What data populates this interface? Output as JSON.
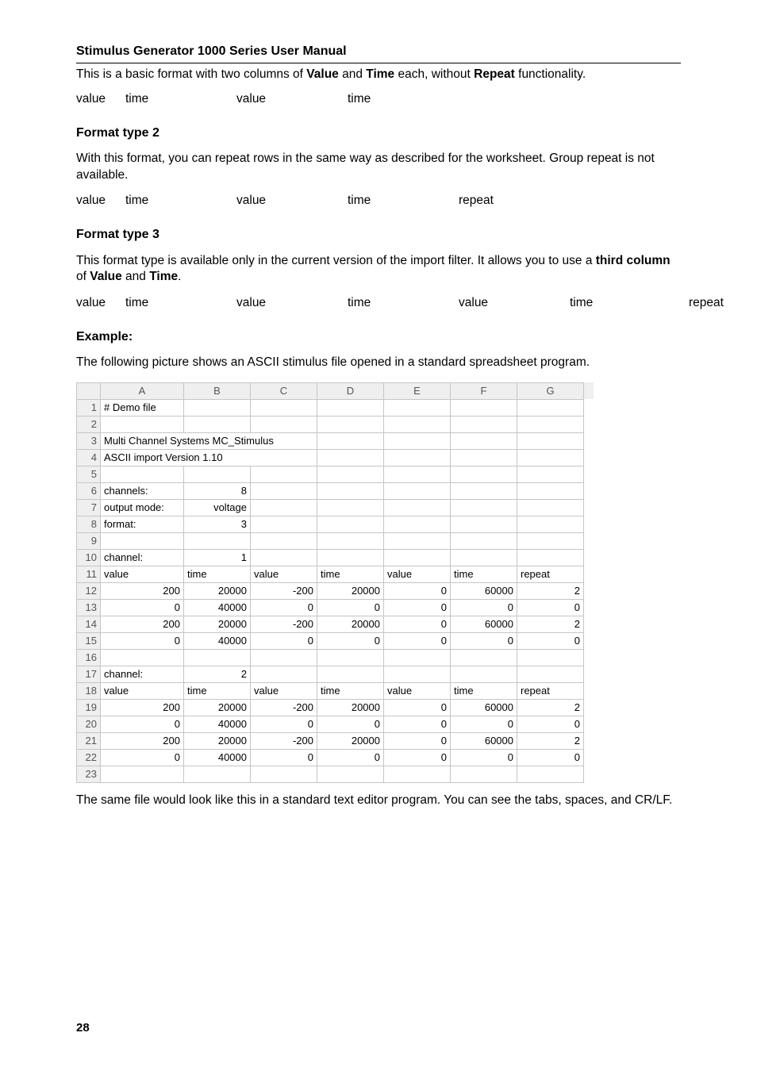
{
  "title": "Stimulus Generator 1000 Series User Manual",
  "intro": {
    "p1_a": "This is a basic format with two columns of ",
    "p1_b": " and ",
    "p1_c": " each, without ",
    "p1_d": " functionality.",
    "b1": "Value",
    "b2": "Time",
    "b3": "Repeat"
  },
  "words": {
    "value": "value",
    "time": "time",
    "repeat": "repeat"
  },
  "fmt2": {
    "h": "Format type 2",
    "p": "With this format, you can repeat rows in the same way as described for the worksheet. Group repeat is not available."
  },
  "fmt3": {
    "h": "Format type 3",
    "p_a": "This format type is available only in the current version of the import filter. It allows you to use a ",
    "p_b": " of ",
    "p_c": " and ",
    "p_d": ".",
    "b1": "third column",
    "b2": "Value",
    "b3": "Time"
  },
  "example": {
    "h": "Example:",
    "p": "The following picture shows an ASCII stimulus file opened in a standard spreadsheet program.",
    "p2": "The same file would look like this in a standard text editor program. You can see the tabs, spaces, and CR/LF."
  },
  "sheet": {
    "cols": [
      "A",
      "B",
      "C",
      "D",
      "E",
      "F",
      "G"
    ],
    "r1": {
      "A": "# Demo file"
    },
    "r3": {
      "A": "Multi Channel Systems MC_Stimulus"
    },
    "r4": {
      "A": "ASCII import Version 1.10"
    },
    "r6": {
      "A": "channels:",
      "B": "8"
    },
    "r7": {
      "A": "output mode:",
      "B": "voltage"
    },
    "r8": {
      "A": "format:",
      "B": "3"
    },
    "r10": {
      "A": "channel:",
      "B": "1"
    },
    "r11": {
      "A": "value",
      "B": "time",
      "C": "value",
      "D": "time",
      "E": "value",
      "F": "time",
      "G": "repeat"
    },
    "r12": {
      "A": "200",
      "B": "20000",
      "C": "-200",
      "D": "20000",
      "E": "0",
      "F": "60000",
      "G": "2"
    },
    "r13": {
      "A": "0",
      "B": "40000",
      "C": "0",
      "D": "0",
      "E": "0",
      "F": "0",
      "G": "0"
    },
    "r14": {
      "A": "200",
      "B": "20000",
      "C": "-200",
      "D": "20000",
      "E": "0",
      "F": "60000",
      "G": "2"
    },
    "r15": {
      "A": "0",
      "B": "40000",
      "C": "0",
      "D": "0",
      "E": "0",
      "F": "0",
      "G": "0"
    },
    "r17": {
      "A": "channel:",
      "B": "2"
    },
    "r18": {
      "A": "value",
      "B": "time",
      "C": "value",
      "D": "time",
      "E": "value",
      "F": "time",
      "G": "repeat"
    },
    "r19": {
      "A": "200",
      "B": "20000",
      "C": "-200",
      "D": "20000",
      "E": "0",
      "F": "60000",
      "G": "2"
    },
    "r20": {
      "A": "0",
      "B": "40000",
      "C": "0",
      "D": "0",
      "E": "0",
      "F": "0",
      "G": "0"
    },
    "r21": {
      "A": "200",
      "B": "20000",
      "C": "-200",
      "D": "20000",
      "E": "0",
      "F": "60000",
      "G": "2"
    },
    "r22": {
      "A": "0",
      "B": "40000",
      "C": "0",
      "D": "0",
      "E": "0",
      "F": "0",
      "G": "0"
    }
  },
  "page_number": "28"
}
